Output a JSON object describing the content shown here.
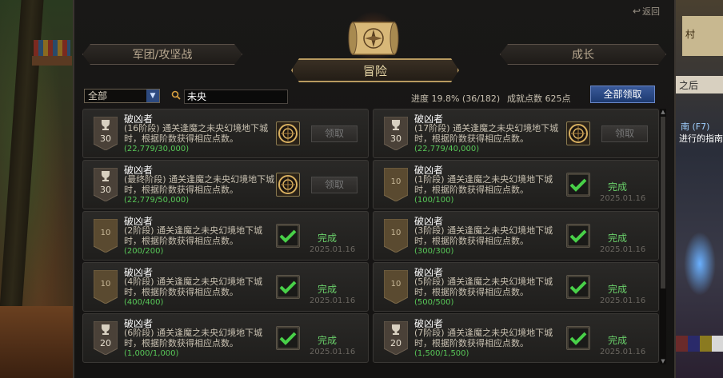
{
  "background": {
    "sign_village": "村",
    "sign_after": "之后",
    "guide_label": "南 (F7)",
    "guide_text": "进行的指南"
  },
  "window": {
    "return_label": "返回",
    "tabs": {
      "legion": "军团/攻坚战",
      "adventure": "冒险",
      "growth": "成长"
    },
    "filter": {
      "selected": "全部"
    },
    "search": {
      "value": "未央"
    },
    "progress": "进度 19.8% (36/182)",
    "points": "成就点数 625点",
    "claim_all": "全部领取"
  },
  "colors": {
    "accent_gold": "#b89a60",
    "complete_green": "#6ad06a",
    "button_blue": "#2d4a80"
  },
  "achievements": [
    {
      "title": "破凶者",
      "desc": "(16阶段) 通关逢魔之未央幻境地下城时，根据阶数获得相应点数。",
      "progress": "(22,779/30,000)",
      "badge": "30",
      "badge_type": "trophy",
      "status": "claim",
      "claim_label": "领取",
      "date": ""
    },
    {
      "title": "破凶者",
      "desc": "(17阶段) 通关逢魔之未央幻境地下城时，根据阶数获得相应点数。",
      "progress": "(22,779/40,000)",
      "badge": "30",
      "badge_type": "trophy",
      "status": "claim",
      "claim_label": "领取",
      "date": ""
    },
    {
      "title": "破凶者",
      "desc": "(最终阶段) 通关逢魔之未央幻境地下城时，根据阶数获得相应点数。",
      "progress": "(22,779/50,000)",
      "badge": "30",
      "badge_type": "trophy",
      "status": "claim",
      "claim_label": "领取",
      "date": ""
    },
    {
      "title": "破凶者",
      "desc": "(1阶段) 通关逢魔之未央幻境地下城时，根据阶数获得相应点数。",
      "progress": "(100/100)",
      "badge": "10",
      "badge_type": "plain",
      "status": "done",
      "done_label": "完成",
      "date": "2025.01.16"
    },
    {
      "title": "破凶者",
      "desc": "(2阶段) 通关逢魔之未央幻境地下城时，根据阶数获得相应点数。",
      "progress": "(200/200)",
      "badge": "10",
      "badge_type": "plain",
      "status": "done",
      "done_label": "完成",
      "date": "2025.01.16"
    },
    {
      "title": "破凶者",
      "desc": "(3阶段) 通关逢魔之未央幻境地下城时，根据阶数获得相应点数。",
      "progress": "(300/300)",
      "badge": "10",
      "badge_type": "plain",
      "status": "done",
      "done_label": "完成",
      "date": "2025.01.16"
    },
    {
      "title": "破凶者",
      "desc": "(4阶段) 通关逢魔之未央幻境地下城时，根据阶数获得相应点数。",
      "progress": "(400/400)",
      "badge": "10",
      "badge_type": "plain",
      "status": "done",
      "done_label": "完成",
      "date": "2025.01.16"
    },
    {
      "title": "破凶者",
      "desc": "(5阶段) 通关逢魔之未央幻境地下城时，根据阶数获得相应点数。",
      "progress": "(500/500)",
      "badge": "10",
      "badge_type": "plain",
      "status": "done",
      "done_label": "完成",
      "date": "2025.01.16"
    },
    {
      "title": "破凶者",
      "desc": "(6阶段) 通关逢魔之未央幻境地下城时，根据阶数获得相应点数。",
      "progress": "(1,000/1,000)",
      "badge": "20",
      "badge_type": "trophy",
      "status": "done",
      "done_label": "完成",
      "date": "2025.01.16"
    },
    {
      "title": "破凶者",
      "desc": "(7阶段) 通关逢魔之未央幻境地下城时，根据阶数获得相应点数。",
      "progress": "(1,500/1,500)",
      "badge": "20",
      "badge_type": "trophy",
      "status": "done",
      "done_label": "完成",
      "date": "2025.01.16"
    }
  ]
}
